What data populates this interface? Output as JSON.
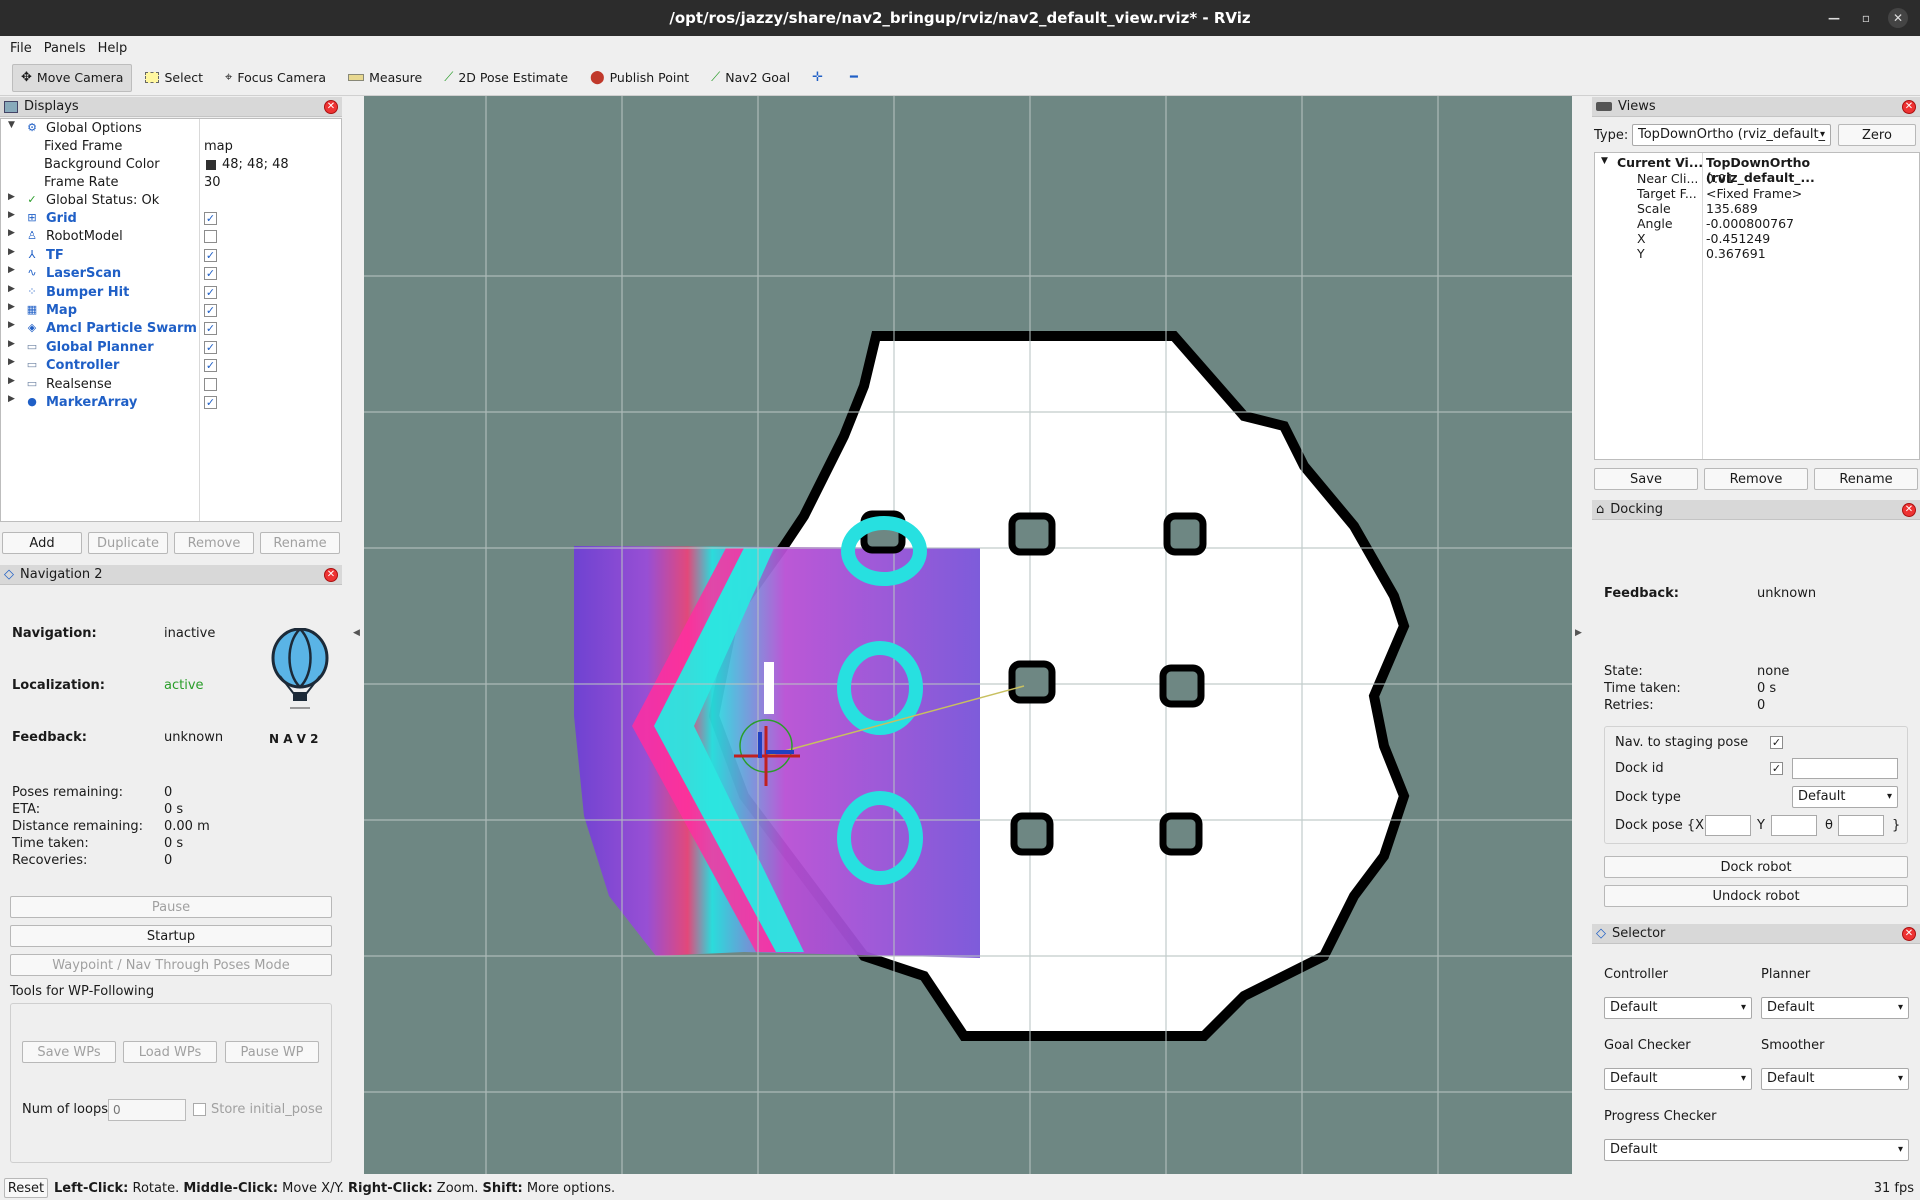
{
  "window": {
    "title": "/opt/ros/jazzy/share/nav2_bringup/rviz/nav2_default_view.rviz* - RViz"
  },
  "menu": [
    "File",
    "Panels",
    "Help"
  ],
  "toolbar": {
    "tools": [
      {
        "label": "Move Camera",
        "icon": "move-camera-icon"
      },
      {
        "label": "Select",
        "icon": "select-icon"
      },
      {
        "label": "Focus Camera",
        "icon": "focus-camera-icon"
      },
      {
        "label": "Measure",
        "icon": "measure-icon"
      },
      {
        "label": "2D Pose Estimate",
        "icon": "pose-estimate-icon"
      },
      {
        "label": "Publish Point",
        "icon": "publish-point-icon"
      },
      {
        "label": "Nav2 Goal",
        "icon": "nav2-goal-icon"
      }
    ]
  },
  "displays": {
    "title": "Displays",
    "global_options": "Global Options",
    "fixed_frame_label": "Fixed Frame",
    "fixed_frame_value": "map",
    "bg_color_label": "Background Color",
    "bg_color_value": "48; 48; 48",
    "frame_rate_label": "Frame Rate",
    "frame_rate_value": "30",
    "global_status": "Global Status: Ok",
    "items": [
      {
        "label": "Grid",
        "checked": true,
        "bold": true
      },
      {
        "label": "RobotModel",
        "checked": false,
        "bold": false
      },
      {
        "label": "TF",
        "checked": true,
        "bold": true
      },
      {
        "label": "LaserScan",
        "checked": true,
        "bold": true
      },
      {
        "label": "Bumper Hit",
        "checked": true,
        "bold": true
      },
      {
        "label": "Map",
        "checked": true,
        "bold": true
      },
      {
        "label": "Amcl Particle Swarm",
        "checked": true,
        "bold": true
      },
      {
        "label": "Global Planner",
        "checked": true,
        "bold": true
      },
      {
        "label": "Controller",
        "checked": true,
        "bold": true
      },
      {
        "label": "Realsense",
        "checked": false,
        "bold": false
      },
      {
        "label": "MarkerArray",
        "checked": true,
        "bold": true
      }
    ],
    "buttons": {
      "add": "Add",
      "duplicate": "Duplicate",
      "remove": "Remove",
      "rename": "Rename"
    }
  },
  "nav2": {
    "title": "Navigation 2",
    "navigation_label": "Navigation:",
    "navigation_value": "inactive",
    "localization_label": "Localization:",
    "localization_value": "active",
    "feedback_label": "Feedback:",
    "feedback_value": "unknown",
    "logo_text": "N A V 2",
    "poses_label": "Poses remaining:",
    "poses_value": "0",
    "eta_label": "ETA:",
    "eta_value": "0 s",
    "distance_label": "Distance remaining:",
    "distance_value": "0.00 m",
    "time_label": "Time taken:",
    "time_value": "0 s",
    "recoveries_label": "Recoveries:",
    "recoveries_value": "0",
    "pause": "Pause",
    "startup": "Startup",
    "waypoint_mode": "Waypoint / Nav Through Poses Mode",
    "wp_tools_title": "Tools for WP-Following",
    "save_wps": "Save WPs",
    "load_wps": "Load WPs",
    "pause_wp": "Pause WP",
    "num_loops_label": "Num of loops",
    "num_loops_placeholder": "0",
    "store_initial": "Store initial_pose"
  },
  "views": {
    "title": "Views",
    "type_label": "Type:",
    "type_value": "TopDownOrtho (rviz_default_",
    "zero": "Zero",
    "current_view_label": "Current Vi...",
    "current_view_value": "TopDownOrtho (rviz_default_...",
    "props": [
      {
        "k": "Near Cli...",
        "v": "0.01"
      },
      {
        "k": "Target F...",
        "v": "<Fixed Frame>"
      },
      {
        "k": "Scale",
        "v": "135.689"
      },
      {
        "k": "Angle",
        "v": "-0.000800767"
      },
      {
        "k": "X",
        "v": "-0.451249"
      },
      {
        "k": "Y",
        "v": "0.367691"
      }
    ],
    "save": "Save",
    "remove": "Remove",
    "rename": "Rename"
  },
  "docking": {
    "title": "Docking",
    "feedback_label": "Feedback:",
    "feedback_value": "unknown",
    "state_label": "State:",
    "state_value": "none",
    "time_label": "Time taken:",
    "time_value": "0 s",
    "retries_label": "Retries:",
    "retries_value": "0",
    "staging_label": "Nav. to staging pose",
    "dock_id_label": "Dock id",
    "dock_type_label": "Dock type",
    "dock_type_value": "Default",
    "dock_pose_label": "Dock pose {X",
    "y_label": "Y",
    "theta_label": "θ",
    "close_brace": "}",
    "dock_robot": "Dock robot",
    "undock_robot": "Undock robot"
  },
  "selector": {
    "title": "Selector",
    "controller_label": "Controller",
    "controller_value": "Default",
    "planner_label": "Planner",
    "planner_value": "Default",
    "goal_checker_label": "Goal Checker",
    "goal_checker_value": "Default",
    "smoother_label": "Smoother",
    "smoother_value": "Default",
    "progress_checker_label": "Progress Checker",
    "progress_checker_value": "Default"
  },
  "status": {
    "reset": "Reset",
    "left_click_key": "Left-Click:",
    "left_click": " Rotate. ",
    "middle_click_key": "Middle-Click:",
    "middle_click": " Move X/Y. ",
    "right_click_key": "Right-Click:",
    "right_click": " Zoom. ",
    "shift_key": "Shift:",
    "shift": " More options.",
    "fps": "31 fps"
  },
  "colors": {
    "accent_blue": "#1f5fc6",
    "active_green": "#2a9d2a",
    "viewport_bg": "#6e8783",
    "close_red": "#e33333"
  }
}
